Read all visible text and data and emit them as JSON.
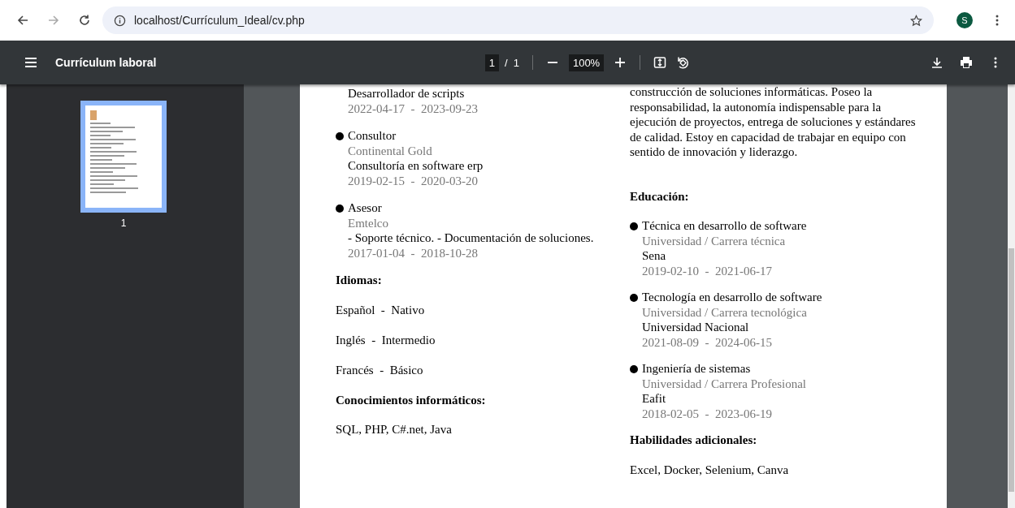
{
  "browser": {
    "url": "localhost/Currículum_Ideal/cv.php",
    "profile_initial": "S",
    "bookmarked": false
  },
  "viewer": {
    "title": "Currículum laboral",
    "page_current": "1",
    "page_separator": "/",
    "page_total": "1",
    "zoom": "100%"
  },
  "thumbnails": [
    {
      "label": "1",
      "selected": true
    }
  ],
  "document": {
    "left": {
      "experience": [
        {
          "bullet": false,
          "description": "Desarrollador de scripts",
          "dates": "2022-04-17  -  2023-09-23"
        },
        {
          "bullet": true,
          "title": "Consultor",
          "company": "Continental Gold",
          "description": "Consultoría en software erp",
          "dates": "2019-02-15  -  2020-03-20"
        },
        {
          "bullet": true,
          "title": "Asesor",
          "company": "Emtelco",
          "description": "- Soporte técnico. - Documentación de soluciones.",
          "dates": "2017-01-04  -  2018-10-28"
        }
      ],
      "languages_heading": "Idiomas:",
      "languages": [
        "Español  -  Nativo",
        "Inglés  -  Intermedio",
        "Francés  -  Básico"
      ],
      "it_heading": "Conocimientos informáticos:",
      "it_skills": "SQL, PHP, C#.net, Java"
    },
    "right": {
      "profile_text": "construcción de soluciones informáticas. Poseo la responsabilidad, la autonomía indispensable para la ejecución de proyectos, entrega de soluciones y estándares de calidad. Estoy en capacidad de trabajar en equipo con sentido de innovación y liderazgo.",
      "education_heading": "Educación:",
      "education": [
        {
          "title": "Técnica en desarrollo de software",
          "type": "Universidad / Carrera técnica",
          "institution": "Sena",
          "dates": "2019-02-10  -  2021-06-17"
        },
        {
          "title": "Tecnología en desarrollo de software",
          "type": "Universidad / Carrera tecnológica",
          "institution": "Universidad Nacional",
          "dates": "2021-08-09  -  2024-06-15"
        },
        {
          "title": "Ingeniería de sistemas",
          "type": "Universidad / Carrera Profesional",
          "institution": "Eafit",
          "dates": "2018-02-05  -  2023-06-19"
        }
      ],
      "extra_heading": "Habilidades adicionales:",
      "extra_skills": "Excel, Docker, Selenium, Canva"
    }
  }
}
